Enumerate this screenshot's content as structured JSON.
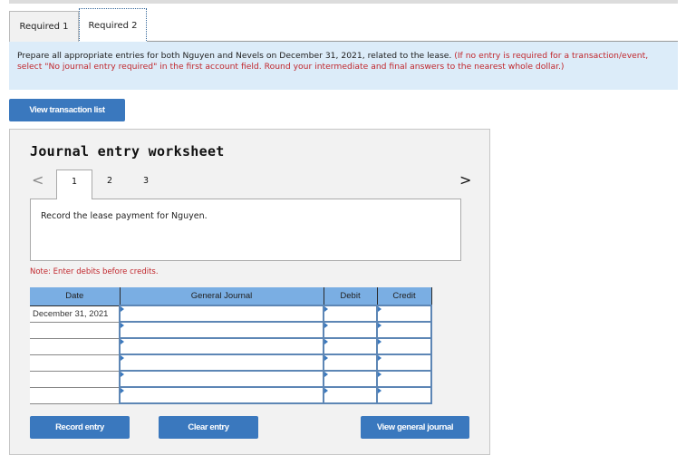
{
  "tabs": [
    {
      "label": "Required 1",
      "active": false
    },
    {
      "label": "Required 2",
      "active": true
    }
  ],
  "instructions": {
    "main": "Prepare all appropriate entries for both Nguyen and Nevels on December 31, 2021, related to the lease.",
    "note": "(If no entry is required for a transaction/event, select \"No journal entry required\" in the first account field. Round your intermediate and final answers to the nearest whole dollar.)"
  },
  "buttons": {
    "view_transaction_list": "View transaction list",
    "record_entry": "Record entry",
    "clear_entry": "Clear entry",
    "view_general_journal": "View general journal"
  },
  "worksheet": {
    "title": "Journal entry worksheet",
    "prev_icon": "<",
    "next_icon": ">",
    "steps": [
      "1",
      "2",
      "3"
    ],
    "active_step": "1",
    "description": "Record the lease payment for Nguyen.",
    "note": "Note: Enter debits before credits."
  },
  "table": {
    "headers": {
      "date": "Date",
      "general_journal": "General Journal",
      "debit": "Debit",
      "credit": "Credit"
    },
    "rows": [
      {
        "date": "December 31, 2021",
        "account": "",
        "debit": "",
        "credit": ""
      },
      {
        "date": "",
        "account": "",
        "debit": "",
        "credit": ""
      },
      {
        "date": "",
        "account": "",
        "debit": "",
        "credit": ""
      },
      {
        "date": "",
        "account": "",
        "debit": "",
        "credit": ""
      },
      {
        "date": "",
        "account": "",
        "debit": "",
        "credit": ""
      },
      {
        "date": "",
        "account": "",
        "debit": "",
        "credit": ""
      }
    ]
  }
}
